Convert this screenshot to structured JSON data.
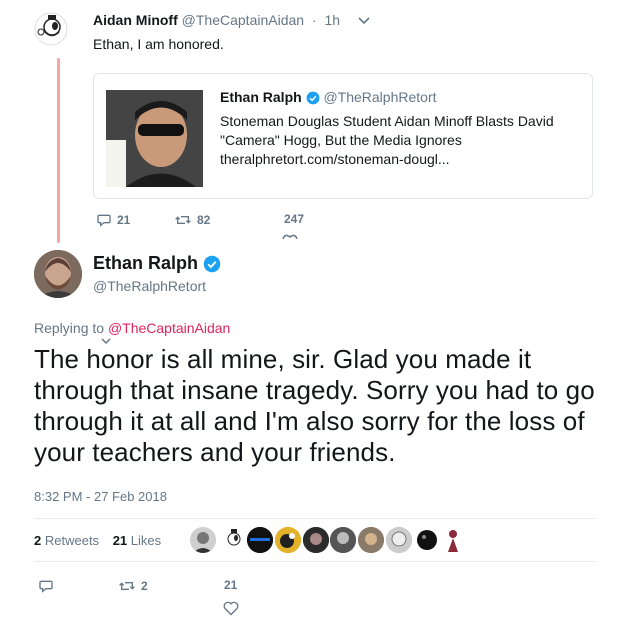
{
  "parent": {
    "name": "Aidan Minoff",
    "handle": "@TheCaptainAidan",
    "separator": "·",
    "time": "1h",
    "text": "Ethan, I am honored.",
    "quote": {
      "name": "Ethan Ralph",
      "handle": "@TheRalphRetort",
      "headline_line1": "Stoneman Douglas Student Aidan Minoff Blasts David",
      "headline_line2": "\"Camera\" Hogg, But the Media Ignores",
      "url": "theralphretort.com/stoneman-dougl..."
    },
    "actions": {
      "replies": "21",
      "retweets": "82",
      "likes": "247"
    }
  },
  "main": {
    "name": "Ethan Ralph",
    "handle": "@TheRalphRetort",
    "replying_prefix": "Replying to ",
    "replying_to": "@TheCaptainAidan",
    "text": "The honor is all mine, sir. Glad you made it through that insane tragedy. Sorry you had to go through it at all and I'm also sorry for the loss of your teachers and your friends.",
    "timestamp": "8:32 PM - 27 Feb 2018",
    "stats": {
      "retweets_count": "2",
      "retweets_label": "Retweets",
      "likes_count": "21",
      "likes_label": "Likes"
    },
    "actions": {
      "retweets": "2",
      "likes": "21"
    }
  },
  "colors": {
    "accent": "#1da1f2",
    "link": "#e0245e",
    "thread_line": "#f4a5a5",
    "muted": "#657786"
  }
}
